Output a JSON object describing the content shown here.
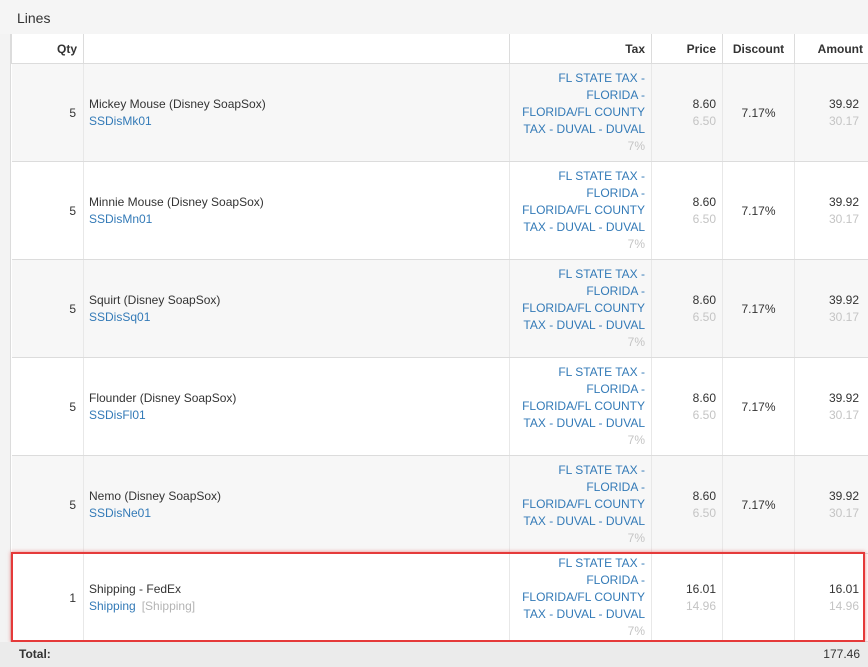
{
  "panel": {
    "title": "Lines"
  },
  "columns": {
    "qty": "Qty",
    "item": "",
    "tax": "Tax",
    "price": "Price",
    "discount": "Discount",
    "amount": "Amount"
  },
  "lines": [
    {
      "qty": "5",
      "name": "Mickey Mouse (Disney SoapSox)",
      "sku": "SSDisMk01",
      "tax_lines": [
        "FL STATE TAX -",
        "FLORIDA -",
        "FLORIDA/FL COUNTY",
        "TAX - DUVAL - DUVAL"
      ],
      "tax_rate": "7%",
      "price": "8.60",
      "price_sub": "6.50",
      "discount": "7.17%",
      "amount": "39.92",
      "amount_sub": "30.17"
    },
    {
      "qty": "5",
      "name": "Minnie Mouse (Disney SoapSox)",
      "sku": "SSDisMn01",
      "tax_lines": [
        "FL STATE TAX -",
        "FLORIDA -",
        "FLORIDA/FL COUNTY",
        "TAX - DUVAL - DUVAL"
      ],
      "tax_rate": "7%",
      "price": "8.60",
      "price_sub": "6.50",
      "discount": "7.17%",
      "amount": "39.92",
      "amount_sub": "30.17"
    },
    {
      "qty": "5",
      "name": "Squirt (Disney SoapSox)",
      "sku": "SSDisSq01",
      "tax_lines": [
        "FL STATE TAX -",
        "FLORIDA -",
        "FLORIDA/FL COUNTY",
        "TAX - DUVAL - DUVAL"
      ],
      "tax_rate": "7%",
      "price": "8.60",
      "price_sub": "6.50",
      "discount": "7.17%",
      "amount": "39.92",
      "amount_sub": "30.17"
    },
    {
      "qty": "5",
      "name": "Flounder (Disney SoapSox)",
      "sku": "SSDisFl01",
      "tax_lines": [
        "FL STATE TAX -",
        "FLORIDA -",
        "FLORIDA/FL COUNTY",
        "TAX - DUVAL - DUVAL"
      ],
      "tax_rate": "7%",
      "price": "8.60",
      "price_sub": "6.50",
      "discount": "7.17%",
      "amount": "39.92",
      "amount_sub": "30.17"
    },
    {
      "qty": "5",
      "name": "Nemo (Disney SoapSox)",
      "sku": "SSDisNe01",
      "tax_lines": [
        "FL STATE TAX -",
        "FLORIDA -",
        "FLORIDA/FL COUNTY",
        "TAX - DUVAL - DUVAL"
      ],
      "tax_rate": "7%",
      "price": "8.60",
      "price_sub": "6.50",
      "discount": "7.17%",
      "amount": "39.92",
      "amount_sub": "30.17"
    }
  ],
  "shipping": {
    "qty": "1",
    "name": "Shipping - FedEx",
    "link": "Shipping",
    "tag": "[Shipping]",
    "tax_lines": [
      "FL STATE TAX -",
      "FLORIDA -",
      "FLORIDA/FL COUNTY",
      "TAX - DUVAL - DUVAL"
    ],
    "tax_rate": "7%",
    "price": "16.01",
    "price_sub": "14.96",
    "discount": "",
    "amount": "16.01",
    "amount_sub": "14.96"
  },
  "footer": {
    "total_label": "Total:",
    "total_value": "177.46"
  },
  "colors": {
    "link": "#337ab7",
    "highlight": "#e53a3a",
    "muted": "#c4c4c4"
  }
}
